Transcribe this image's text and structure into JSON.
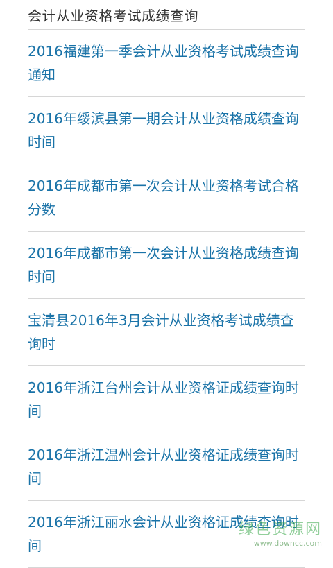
{
  "header": {
    "title": "会计从业资格考试成绩查询"
  },
  "articles": [
    {
      "title": "2016福建第一季会计从业资格考试成绩查询通知"
    },
    {
      "title": "2016年绥滨县第一期会计从业资格成绩查询时间"
    },
    {
      "title": "2016年成都市第一次会计从业资格考试合格分数"
    },
    {
      "title": "2016年成都市第一次会计从业资格成绩查询时间"
    },
    {
      "title": "宝清县2016年3月会计从业资格考试成绩查询时"
    },
    {
      "title": "2016年浙江台州会计从业资格证成绩查询时间"
    },
    {
      "title": "2016年浙江温州会计从业资格证成绩查询时间"
    },
    {
      "title": "2016年浙江丽水会计从业资格证成绩查询时间"
    }
  ],
  "watermark": {
    "title": "绿色资源网",
    "url": "www.downcc.com"
  },
  "colors": {
    "link": "#1a73a8",
    "divider": "#d6d6d6",
    "header_text": "#333333"
  }
}
